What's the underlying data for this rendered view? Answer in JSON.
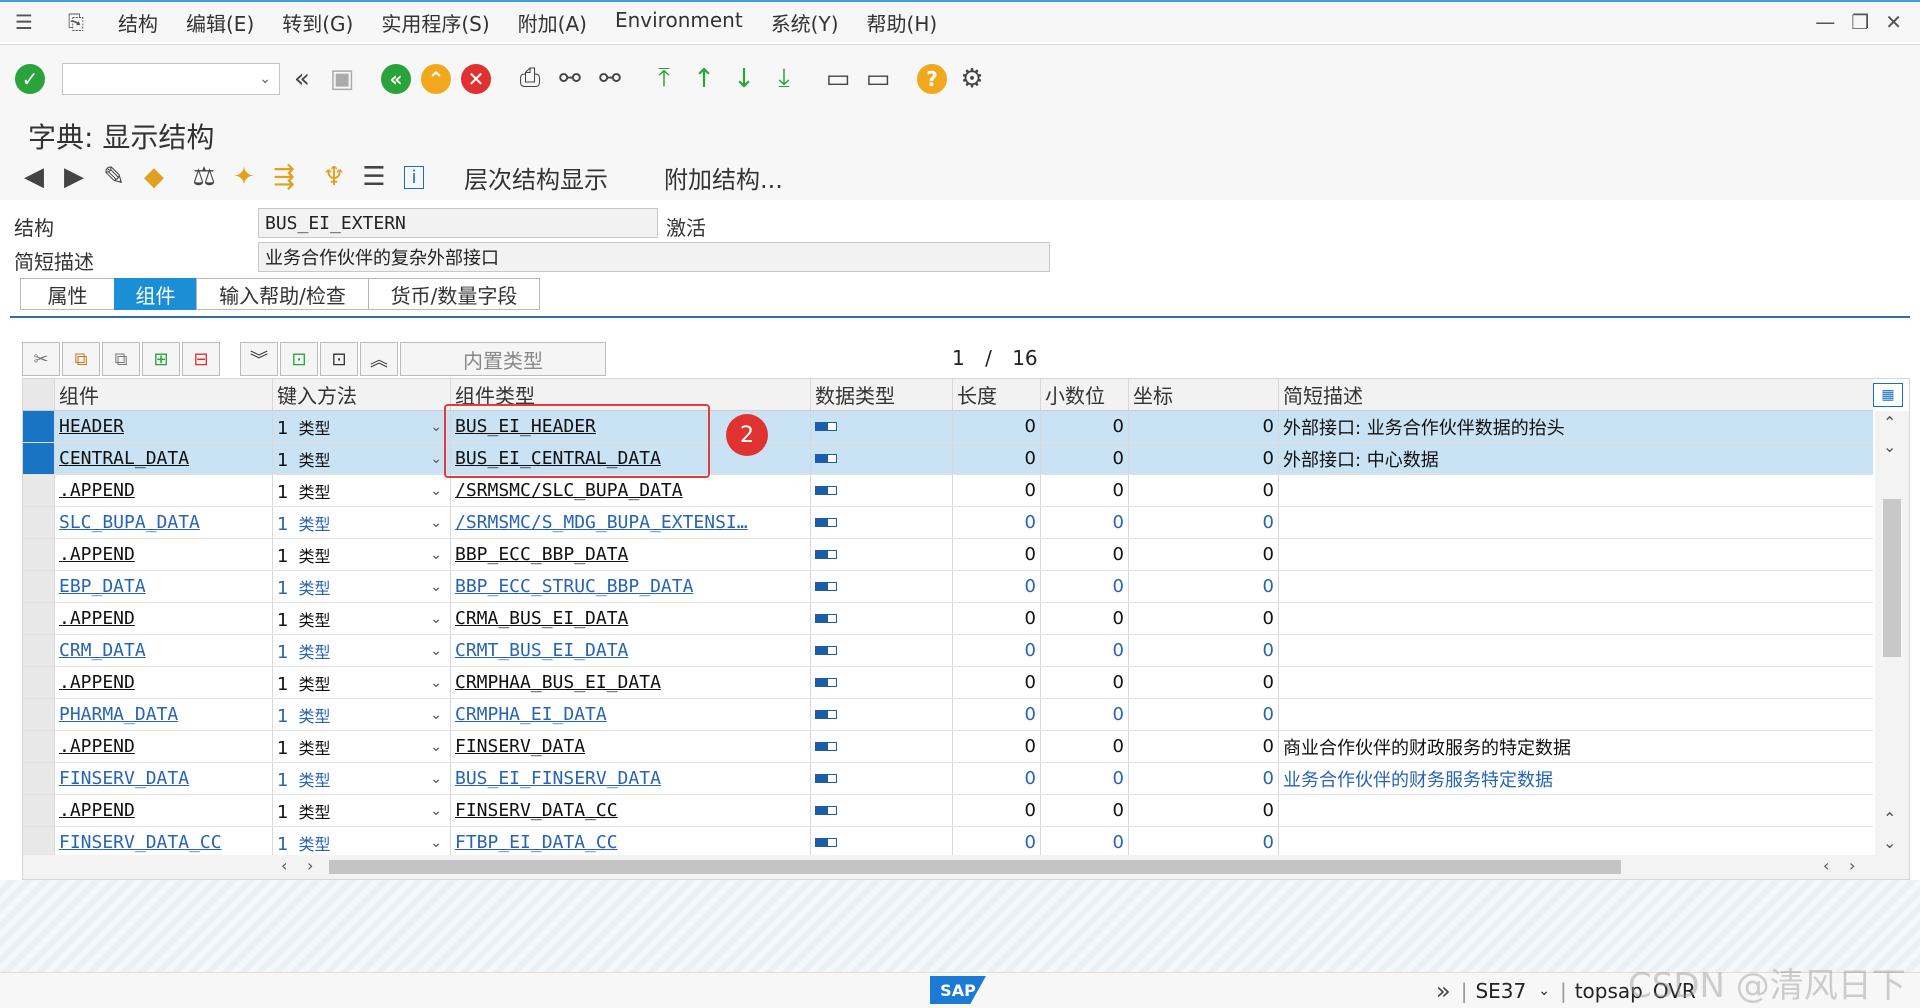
{
  "menu": {
    "items": [
      "结构",
      "编辑(E)",
      "转到(G)",
      "实用程序(S)",
      "附加(A)",
      "Environment",
      "系统(Y)",
      "帮助(H)"
    ]
  },
  "toolbar": {
    "command_field": ""
  },
  "title": "字典: 显示结构",
  "app_toolbar": {
    "hierarchy_label": "层次结构显示",
    "append_label": "附加结构..."
  },
  "header": {
    "structure_label": "结构",
    "structure_value": "BUS_EI_EXTERN",
    "status": "激活",
    "short_desc_label": "简短描述",
    "short_desc_value": "业务合作伙伴的复杂外部接口"
  },
  "tabs": [
    "属性",
    "组件",
    "输入帮助/检查",
    "货币/数量字段"
  ],
  "active_tab": "组件",
  "table_toolbar": {
    "builtin_type_label": "内置类型"
  },
  "pager": {
    "current": "1",
    "separator": "/",
    "total": "16"
  },
  "table": {
    "columns": [
      "组件",
      "键入方法",
      "组件类型",
      "数据类型",
      "长度",
      "小数位",
      "坐标",
      "简短描述"
    ],
    "rows": [
      {
        "component": "HEADER",
        "key_num": "1",
        "key_type": "类型",
        "comp_type": "BUS_EI_HEADER",
        "length": "0",
        "decimals": "0",
        "coord": "0",
        "desc": "外部接口: 业务合作伙伴数据的抬头",
        "selected": true,
        "blue": false
      },
      {
        "component": "CENTRAL_DATA",
        "key_num": "1",
        "key_type": "类型",
        "comp_type": "BUS_EI_CENTRAL_DATA",
        "length": "0",
        "decimals": "0",
        "coord": "0",
        "desc": "外部接口: 中心数据",
        "selected": true,
        "blue": false
      },
      {
        "component": ".APPEND",
        "key_num": "1",
        "key_type": "类型",
        "comp_type": "/SRMSMC/SLC_BUPA_DATA",
        "length": "0",
        "decimals": "0",
        "coord": "0",
        "desc": "",
        "selected": false,
        "blue": false
      },
      {
        "component": "SLC_BUPA_DATA",
        "key_num": "1",
        "key_type": "类型",
        "comp_type": "/SRMSMC/S_MDG_BUPA_EXTENSI…",
        "length": "0",
        "decimals": "0",
        "coord": "0",
        "desc": "",
        "selected": false,
        "blue": true
      },
      {
        "component": ".APPEND",
        "key_num": "1",
        "key_type": "类型",
        "comp_type": "BBP_ECC_BBP_DATA",
        "length": "0",
        "decimals": "0",
        "coord": "0",
        "desc": "",
        "selected": false,
        "blue": false
      },
      {
        "component": "EBP_DATA",
        "key_num": "1",
        "key_type": "类型",
        "comp_type": "BBP_ECC_STRUC_BBP_DATA",
        "length": "0",
        "decimals": "0",
        "coord": "0",
        "desc": "",
        "selected": false,
        "blue": true
      },
      {
        "component": ".APPEND",
        "key_num": "1",
        "key_type": "类型",
        "comp_type": "CRMA_BUS_EI_DATA",
        "length": "0",
        "decimals": "0",
        "coord": "0",
        "desc": "",
        "selected": false,
        "blue": false
      },
      {
        "component": "CRM_DATA",
        "key_num": "1",
        "key_type": "类型",
        "comp_type": "CRMT_BUS_EI_DATA",
        "length": "0",
        "decimals": "0",
        "coord": "0",
        "desc": "",
        "selected": false,
        "blue": true
      },
      {
        "component": ".APPEND",
        "key_num": "1",
        "key_type": "类型",
        "comp_type": "CRMPHAA_BUS_EI_DATA",
        "length": "0",
        "decimals": "0",
        "coord": "0",
        "desc": "",
        "selected": false,
        "blue": false
      },
      {
        "component": "PHARMA_DATA",
        "key_num": "1",
        "key_type": "类型",
        "comp_type": "CRMPHA_EI_DATA",
        "length": "0",
        "decimals": "0",
        "coord": "0",
        "desc": "",
        "selected": false,
        "blue": true
      },
      {
        "component": ".APPEND",
        "key_num": "1",
        "key_type": "类型",
        "comp_type": "FINSERV_DATA",
        "length": "0",
        "decimals": "0",
        "coord": "0",
        "desc": "商业合作伙伴的财政服务的特定数据",
        "selected": false,
        "blue": false
      },
      {
        "component": "FINSERV_DATA",
        "key_num": "1",
        "key_type": "类型",
        "comp_type": "BUS_EI_FINSERV_DATA",
        "length": "0",
        "decimals": "0",
        "coord": "0",
        "desc": "业务合作伙伴的财务服务特定数据",
        "selected": false,
        "blue": true
      },
      {
        "component": ".APPEND",
        "key_num": "1",
        "key_type": "类型",
        "comp_type": "FINSERV_DATA_CC",
        "length": "0",
        "decimals": "0",
        "coord": "0",
        "desc": "",
        "selected": false,
        "blue": false
      },
      {
        "component": "FINSERV_DATA_CC",
        "key_num": "1",
        "key_type": "类型",
        "comp_type": "FTBP_EI_DATA_CC",
        "length": "0",
        "decimals": "0",
        "coord": "0",
        "desc": "",
        "selected": false,
        "blue": true
      }
    ]
  },
  "annotation": {
    "badge": "2"
  },
  "status_bar": {
    "logo": "SAP",
    "transaction": "SE37",
    "server": "topsap",
    "mode": "OVR"
  },
  "watermark": "CSDN @清风日下",
  "colors": {
    "accent": "#1a8fd6",
    "link_blue": "#2864b4",
    "selection": "#c9e3f5",
    "annotation_red": "#e43c3c"
  }
}
